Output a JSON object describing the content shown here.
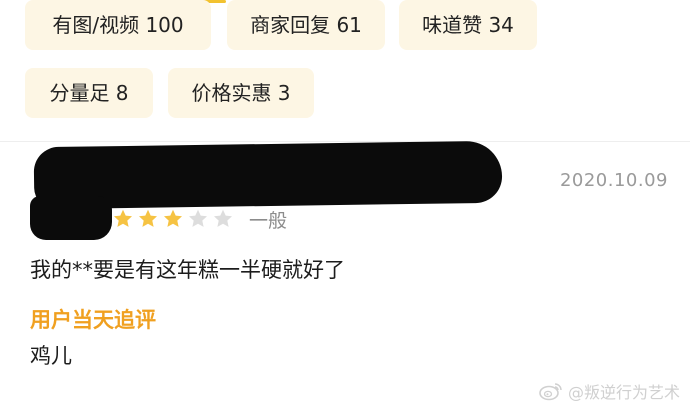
{
  "filters": {
    "tags": [
      {
        "label": "有图/视频 100"
      },
      {
        "label": "商家回复 61"
      },
      {
        "label": "味道赞 34"
      },
      {
        "label": "分量足 8"
      },
      {
        "label": "价格实惠 3"
      }
    ]
  },
  "review": {
    "date": "2020.10.09",
    "rating": {
      "filled": 3,
      "total": 5,
      "label": "一般",
      "filled_color": "#f6c343",
      "empty_color": "#dddddd"
    },
    "text": "我的**要是有这年糕一半硬就好了",
    "followup": {
      "label": "用户当天追评",
      "text": "鸡儿",
      "label_color": "#f0a020"
    }
  },
  "watermark": {
    "text": "@叛逆行为艺术",
    "icon": "weibo-icon"
  },
  "colors": {
    "tag_background": "#fdf6e4",
    "accent": "#f2c230"
  }
}
